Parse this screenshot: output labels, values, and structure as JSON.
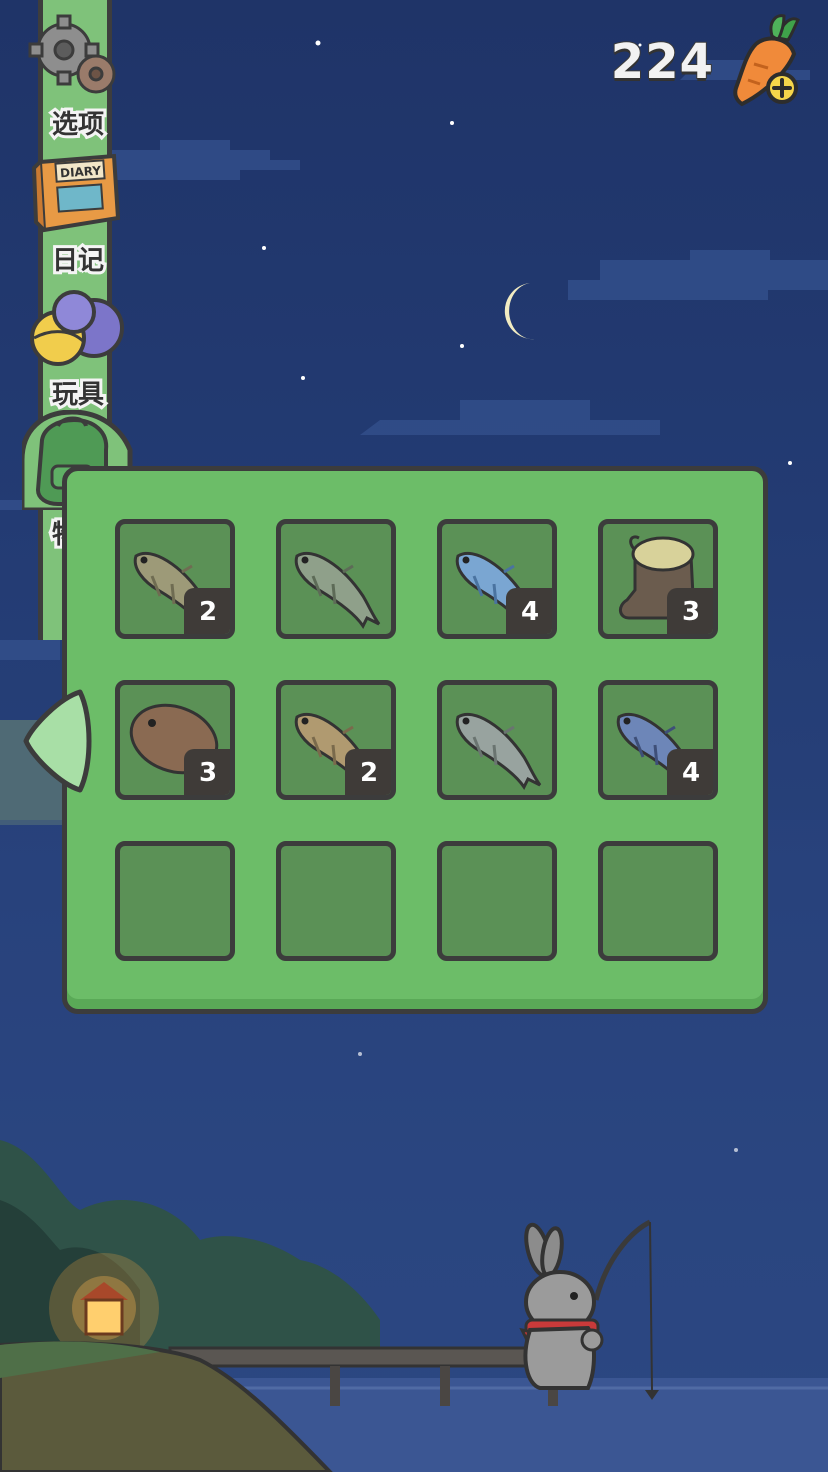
{
  "currency": {
    "amount": "224",
    "icon": "carrot-plus-icon"
  },
  "side_menu": {
    "items": [
      {
        "label": "选项",
        "icon": "gear-icon"
      },
      {
        "label": "日记",
        "icon": "diary-book-icon"
      },
      {
        "label": "玩具",
        "icon": "toy-balls-icon"
      },
      {
        "label": "物品",
        "icon": "backpack-icon"
      }
    ],
    "diary_cover_text": "DIARY"
  },
  "inventory": {
    "slots": [
      {
        "item": "bass",
        "count": "2"
      },
      {
        "item": "largemouth-bass",
        "count": ""
      },
      {
        "item": "salmon",
        "count": "4"
      },
      {
        "item": "old-boot",
        "count": "3"
      },
      {
        "item": "flounder",
        "count": "3"
      },
      {
        "item": "catfish",
        "count": "2"
      },
      {
        "item": "carp",
        "count": ""
      },
      {
        "item": "tuna",
        "count": "4"
      },
      {
        "item": "",
        "count": ""
      },
      {
        "item": "",
        "count": ""
      },
      {
        "item": "",
        "count": ""
      },
      {
        "item": "",
        "count": ""
      }
    ]
  },
  "colors": {
    "panel_green": "#6cbd68",
    "slot_green": "#5b9156",
    "outline": "#3c3c3c",
    "night_sky": "#233b73"
  }
}
